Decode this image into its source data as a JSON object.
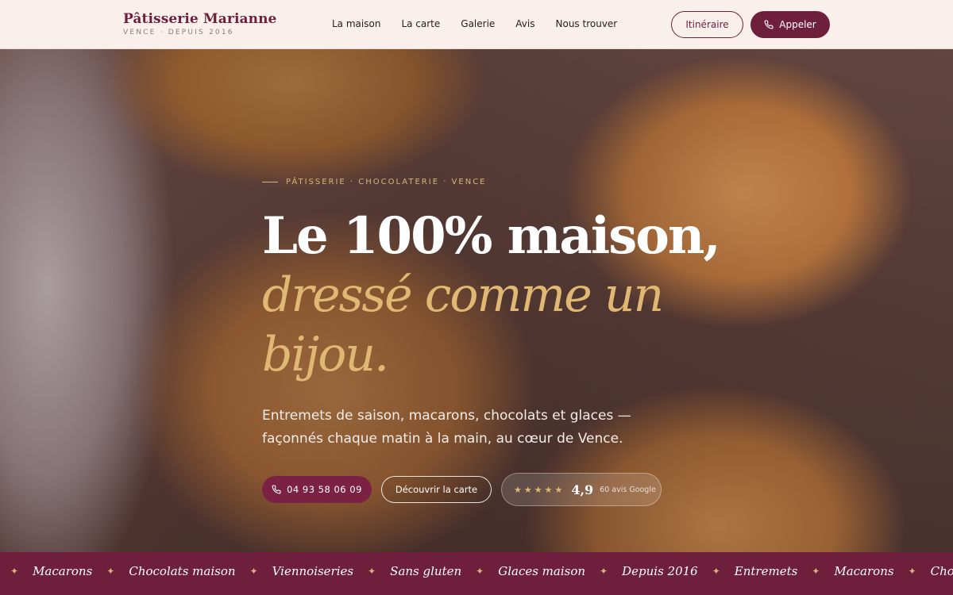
{
  "header": {
    "brand_name": "Pâtisserie Marianne",
    "brand_sub": "VENCE · DEPUIS 2016",
    "nav": [
      "La maison",
      "La carte",
      "Galerie",
      "Avis",
      "Nous trouver"
    ],
    "itinerary_label": "Itinéraire",
    "call_label": "Appeler"
  },
  "hero": {
    "eyebrow": "PÂTISSERIE · CHOCOLATERIE · VENCE",
    "title_line1": "Le 100% maison,",
    "title_line2": "dressé comme un",
    "title_line3": "bijou.",
    "lead": "Entremets de saison, macarons, chocolats et glaces — façonnés chaque matin à la main, au cœur de Vence.",
    "phone_label": "04 93 58 06 09",
    "menu_label": "Découvrir la carte",
    "rating_stars": "★★★★★",
    "rating_score": "4,9",
    "rating_reviews": "60 avis Google"
  },
  "band": {
    "items": [
      "Glaces maison",
      "Macarons",
      "Chocolats maison",
      "Viennoiseries",
      "Sans gluten",
      "Glaces maison",
      "Depuis 2016",
      "Entremets",
      "Macarons",
      "Chocolats maison"
    ],
    "separator": "✦"
  },
  "colors": {
    "brand": "#6e1f3c",
    "gold": "#e0b873",
    "header_bg": "#faf0eb"
  }
}
